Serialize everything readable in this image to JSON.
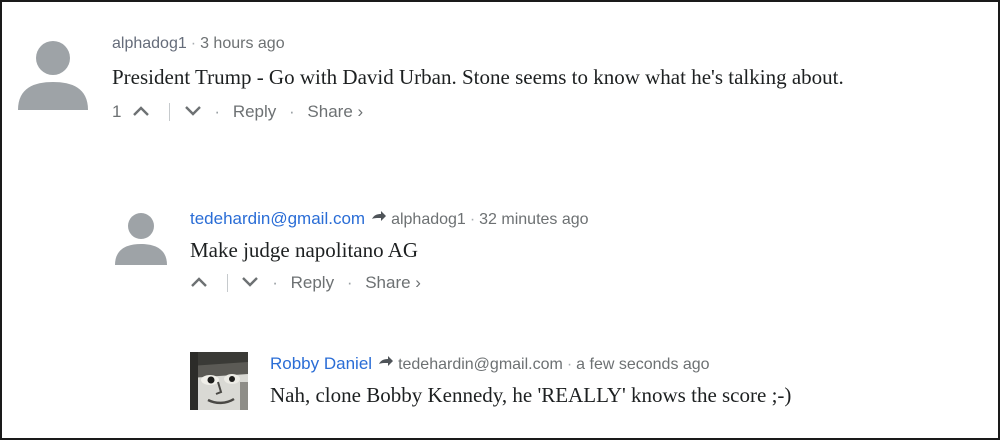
{
  "comments": [
    {
      "author": "alphadog1",
      "time": "3 hours ago",
      "text": "President Trump - Go with David Urban. Stone seems to know what he's talking about.",
      "votes": "1",
      "reply": "Reply",
      "share": "Share ›",
      "avatar": "default-avatar-icon"
    },
    {
      "author": "tedehardin@gmail.com",
      "in_reply_to": "alphadog1",
      "time": "32 minutes ago",
      "text": "Make judge napolitano AG",
      "reply": "Reply",
      "share": "Share ›",
      "avatar": "default-avatar-icon"
    },
    {
      "author": "Robby Daniel",
      "in_reply_to": "tedehardin@gmail.com",
      "time": "a few seconds ago",
      "text": "Nah, clone Bobby Kennedy, he 'REALLY' knows the score ;-)",
      "avatar": "photo-avatar"
    }
  ],
  "colors": {
    "link_author": "#2a6dd6",
    "meta": "#6d7173",
    "avatar_gray": "#9ea3a7"
  }
}
